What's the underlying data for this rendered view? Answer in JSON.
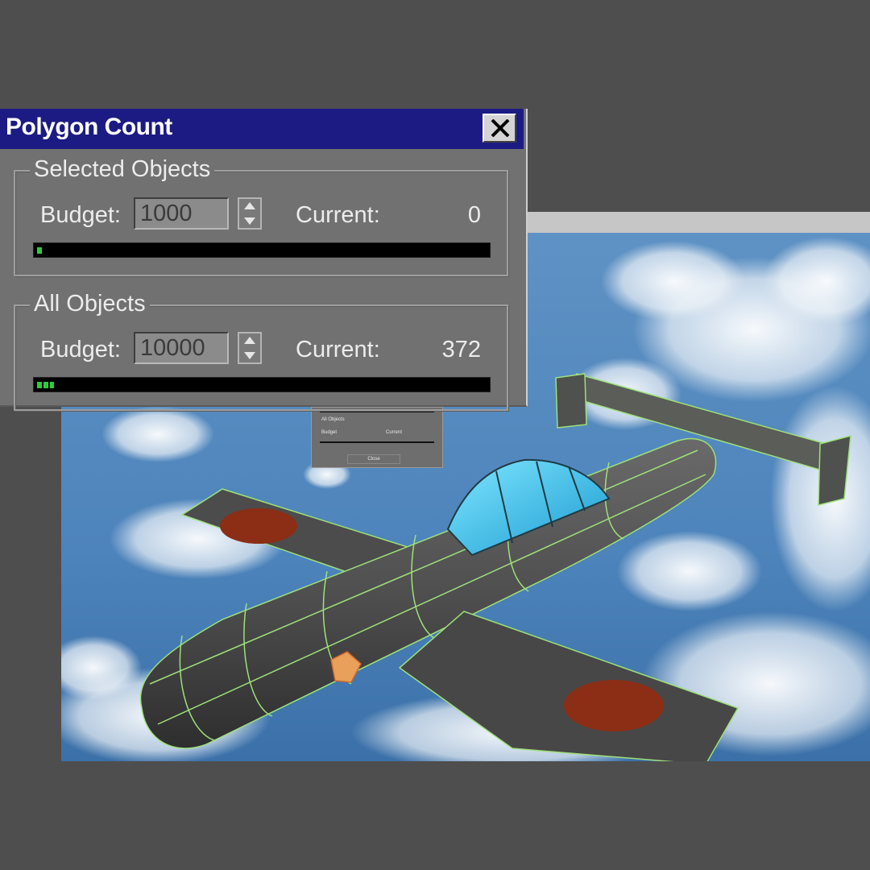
{
  "dialog": {
    "title": "Polygon Count",
    "close_icon": "close-icon",
    "selected_objects": {
      "group_label": "Selected Objects",
      "budget_label": "Budget:",
      "budget_value": "1000",
      "current_label": "Current:",
      "current_value": "0",
      "meter_fraction": 0.01
    },
    "all_objects": {
      "group_label": "All Objects",
      "budget_label": "Budget:",
      "budget_value": "10000",
      "current_label": "Current:",
      "current_value": "372",
      "meter_fraction": 0.037
    }
  },
  "viewport": {
    "description_icon": "airplane-model",
    "reflection_dialog": {
      "group_label": "All Objects",
      "budget_label": "Budget",
      "current_label": "Current",
      "button_label": "Close"
    }
  },
  "colors": {
    "title_bar": "#1b1b83",
    "meter_fill": "#2ecc3a",
    "sky": "#4a86c0",
    "wireframe": "#9ee07a"
  }
}
